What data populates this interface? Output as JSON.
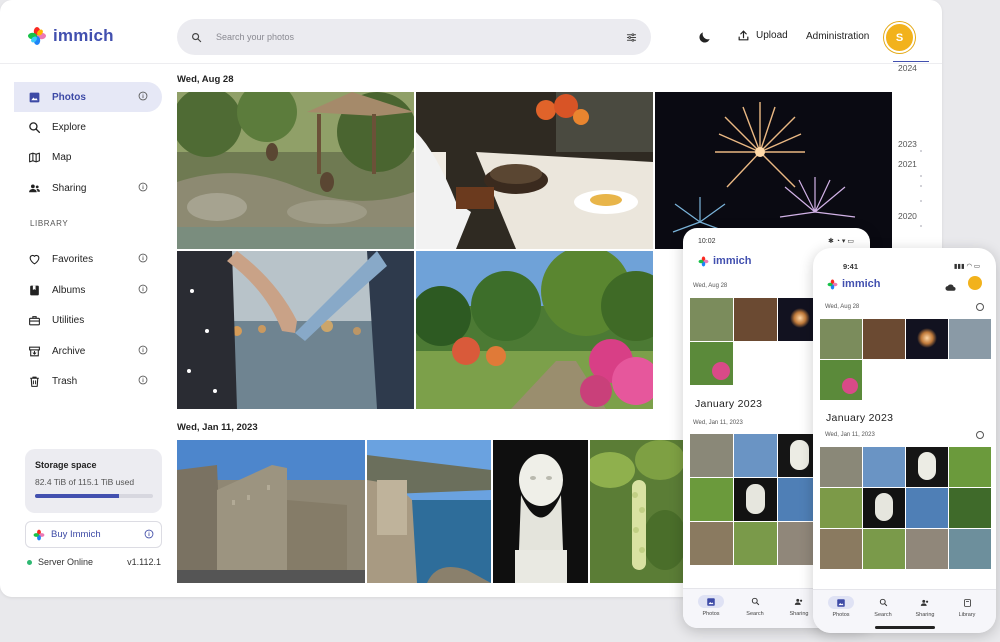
{
  "app": {
    "name": "immich"
  },
  "header": {
    "search_placeholder": "Search your photos",
    "upload_label": "Upload",
    "admin_label": "Administration",
    "avatar_initial": "S"
  },
  "sidebar": {
    "items": [
      {
        "label": "Photos",
        "icon": "photos-icon",
        "info": true
      },
      {
        "label": "Explore",
        "icon": "search-icon",
        "info": false
      },
      {
        "label": "Map",
        "icon": "map-icon",
        "info": false
      },
      {
        "label": "Sharing",
        "icon": "people-icon",
        "info": true
      }
    ],
    "library_title": "LIBRARY",
    "library_items": [
      {
        "label": "Favorites",
        "icon": "heart-icon",
        "info": true
      },
      {
        "label": "Albums",
        "icon": "album-icon",
        "info": true
      },
      {
        "label": "Utilities",
        "icon": "toolbox-icon",
        "info": false
      },
      {
        "label": "Archive",
        "icon": "archive-icon",
        "info": true
      },
      {
        "label": "Trash",
        "icon": "trash-icon",
        "info": true
      }
    ],
    "storage": {
      "title": "Storage space",
      "usage": "82.4 TiB of 115.1 TiB used",
      "fraction": 0.716
    },
    "buy_label": "Buy Immich",
    "server_status": "Server Online",
    "server_version": "v1.112.1"
  },
  "main": {
    "groups": [
      {
        "date": "Wed, Aug 28"
      },
      {
        "date": "Wed, Jan 11, 2023"
      }
    ]
  },
  "timeline": {
    "years": [
      "2024",
      "2023",
      "2021",
      "2020"
    ]
  },
  "phone_android": {
    "time": "10:02",
    "brand": "immich",
    "date1": "Wed, Aug 28",
    "month": "January 2023",
    "date2": "Wed, Jan 11, 2023",
    "nav": [
      "Photos",
      "Search",
      "Sharing"
    ]
  },
  "phone_ios": {
    "time": "9:41",
    "brand": "immich",
    "date1": "Wed, Aug 28",
    "month": "January 2023",
    "date2": "Wed, Jan 11, 2023",
    "nav": [
      "Photos",
      "Search",
      "Sharing",
      "Library"
    ]
  },
  "colors": {
    "accent": "#4250af",
    "avatar": "#f2b21c",
    "online": "#2eb872"
  }
}
